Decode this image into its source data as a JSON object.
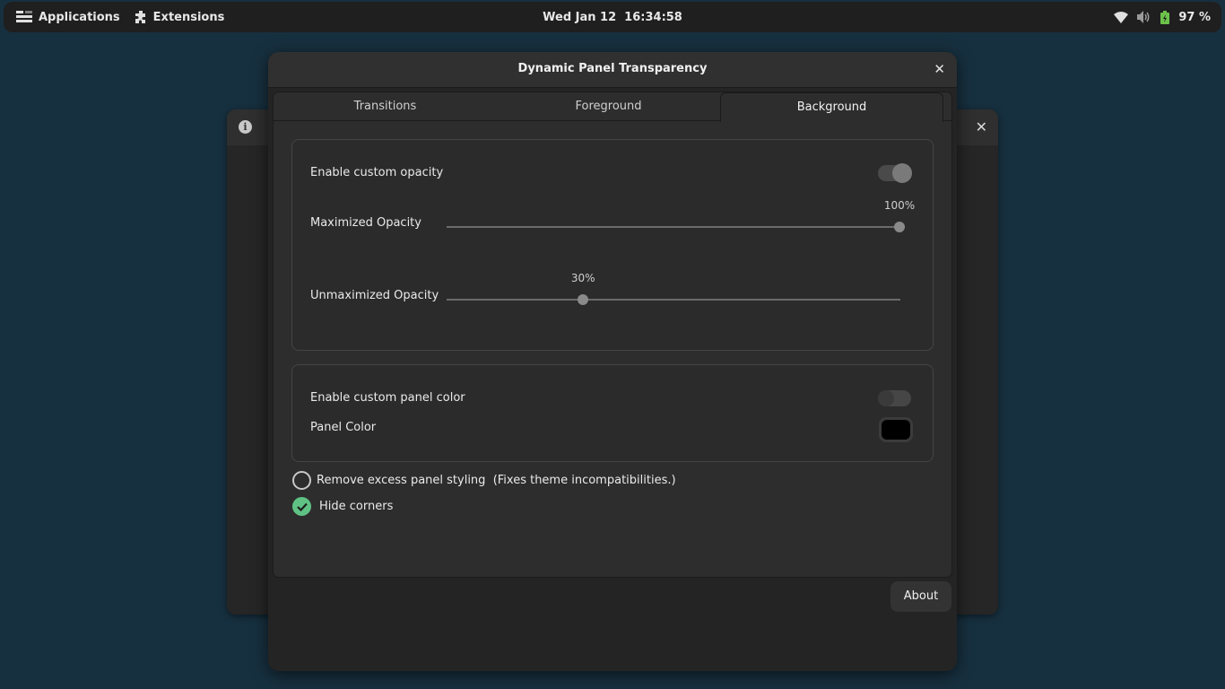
{
  "topbar": {
    "applications_label": "Applications",
    "extensions_label": "Extensions",
    "clock": "Wed Jan 12  16:34:58",
    "battery_text": "97 %",
    "icons": [
      "applications-icon",
      "extensions-icon",
      "wifi-icon",
      "volume-muted-icon",
      "battery-icon"
    ]
  },
  "background_window": {
    "info_glyph": "i",
    "close_glyph": "✕"
  },
  "dialog": {
    "title": "Dynamic Panel Transparency",
    "close_glyph": "✕",
    "tabs": [
      {
        "label": "Transitions",
        "active": false
      },
      {
        "label": "Foreground",
        "active": false
      },
      {
        "label": "Background",
        "active": true
      }
    ],
    "opacity_section": {
      "enable_label": "Enable custom opacity",
      "enable_state": true,
      "maximized": {
        "label": "Maximized Opacity",
        "value_text": "100%",
        "value": 100
      },
      "unmaximized": {
        "label": "Unmaximized Opacity",
        "value_text": "30%",
        "value": 30
      }
    },
    "color_section": {
      "enable_label": "Enable custom panel color",
      "enable_state": false,
      "panel_color_label": "Panel Color",
      "panel_color": "#000000"
    },
    "options": {
      "remove_styling_label": "Remove excess panel styling  (Fixes theme incompatibilities.)",
      "remove_styling_checked": false,
      "hide_corners_label": "Hide corners",
      "hide_corners_checked": true
    },
    "about_label": "About"
  },
  "colors": {
    "desktop_bg": "#17303f",
    "accent_check": "#5fc284",
    "battery_green": "#6cc24a"
  }
}
